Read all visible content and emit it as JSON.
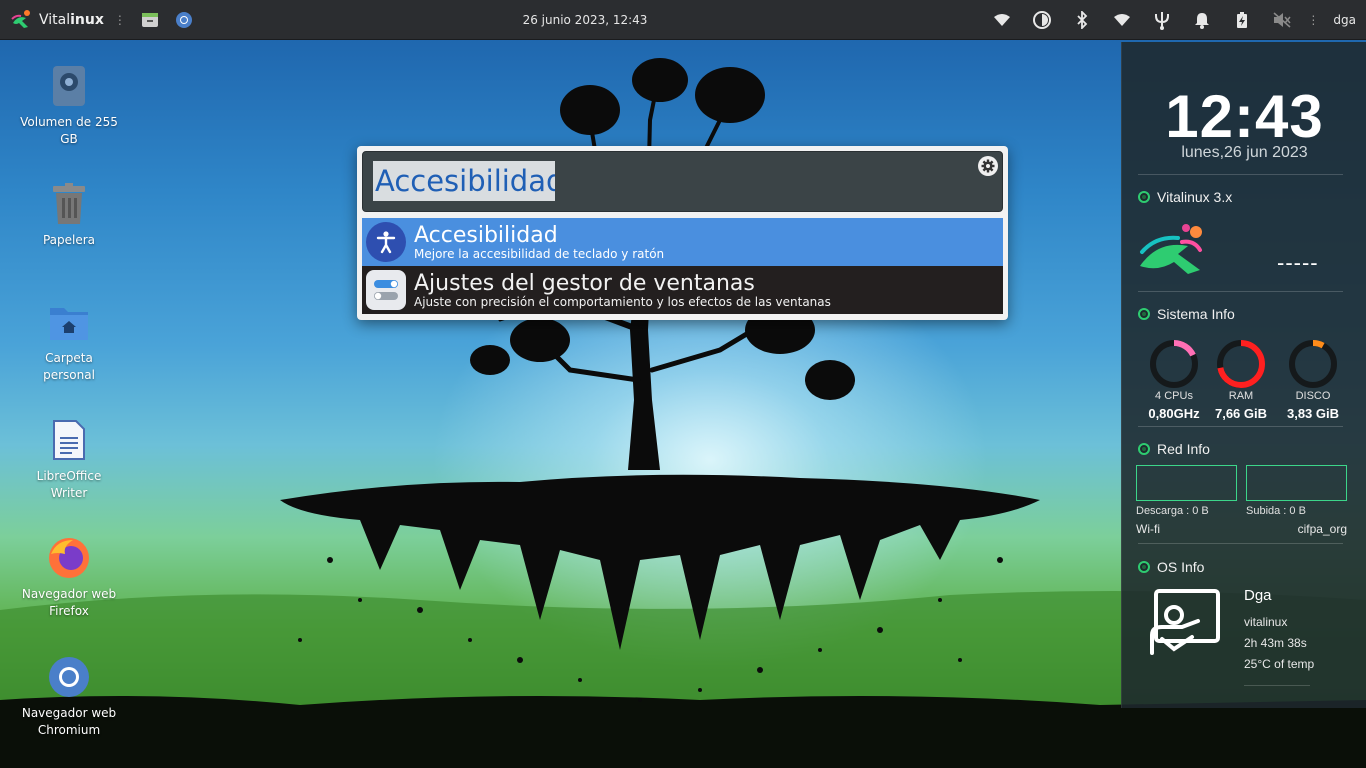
{
  "topbar": {
    "brand_prefix": "Vital",
    "brand_suffix": "inux",
    "datetime": "26 junio 2023, 12:43",
    "user": "dga",
    "tray_icons": [
      "wifi-icon",
      "contrast-icon",
      "bluetooth-icon",
      "wifi-icon",
      "usb-trident-icon",
      "bell-icon",
      "battery-charging-icon",
      "volume-muted-icon"
    ]
  },
  "desktop": {
    "icons": [
      {
        "label": "Volumen de 255 GB",
        "icon": "drive-icon"
      },
      {
        "label": "Papelera",
        "icon": "trash-icon"
      },
      {
        "label": "Carpeta personal",
        "icon": "home-folder-icon"
      },
      {
        "label": "LibreOffice Writer",
        "icon": "writer-icon"
      },
      {
        "label": "Navegador web Firefox",
        "icon": "firefox-icon"
      },
      {
        "label": "Navegador web Chromium",
        "icon": "chromium-icon"
      }
    ]
  },
  "search": {
    "query": "Accesibilidad",
    "results": [
      {
        "title": "Accesibilidad",
        "subtitle": "Mejore la accesibilidad de teclado y ratón",
        "icon": "accessibility-icon"
      },
      {
        "title": "Ajustes del gestor de ventanas",
        "subtitle": "Ajuste con precisión el comportamiento y los efectos de las ventanas",
        "icon": "toggle-settings-icon"
      }
    ]
  },
  "widget": {
    "time": "12:43",
    "date": "lunes,26 jun 2023",
    "sections": {
      "vitalinux": "Vitalinux 3.x",
      "sistema": "Sistema Info",
      "red": "Red Info",
      "os": "OS Info"
    },
    "version_dashes": "-----",
    "gauges": [
      {
        "label": "4 CPUs",
        "value": "0,80GHz",
        "fraction": 0.18,
        "color": "#ff6fb5"
      },
      {
        "label": "RAM",
        "value": "7,66 GiB",
        "fraction": 0.72,
        "color": "#ff2020"
      },
      {
        "label": "DISCO",
        "value": "3,83 GiB",
        "fraction": 0.08,
        "color": "#ff8c1a"
      }
    ],
    "net": {
      "download": "Descarga : 0 B",
      "upload": "Subida : 0 B",
      "iface": "Wi-fi",
      "ssid": "cifpa_org"
    },
    "os": {
      "user": "Dga",
      "host": "vitalinux",
      "uptime": "2h 43m 38s",
      "temp": "25°C of temp"
    }
  }
}
